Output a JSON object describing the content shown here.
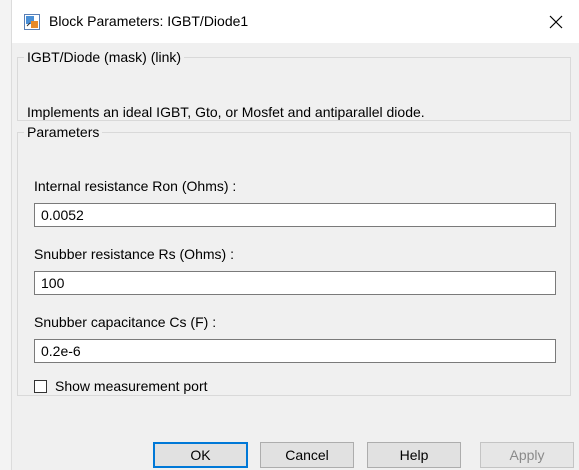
{
  "window": {
    "title": "Block Parameters: IGBT/Diode1",
    "icon": "simulink-block-icon",
    "close_icon": "close-icon"
  },
  "description_group": {
    "legend": "IGBT/Diode (mask) (link)",
    "text": "Implements an ideal  IGBT, Gto, or Mosfet and antiparallel diode."
  },
  "parameters_group": {
    "legend": "Parameters",
    "fields": [
      {
        "label": "Internal resistance Ron (Ohms) :",
        "value": "0.0052"
      },
      {
        "label": "Snubber resistance Rs (Ohms) :",
        "value": "100"
      },
      {
        "label": "Snubber capacitance Cs (F) :",
        "value": "0.2e-6"
      }
    ],
    "checkbox": {
      "label": "Show measurement port",
      "checked": false
    }
  },
  "buttons": {
    "ok": "OK",
    "cancel": "Cancel",
    "help": "Help",
    "apply": "Apply"
  },
  "colors": {
    "dialog_bg": "#f0f0f0",
    "focus_blue": "#0078d7",
    "disabled_text": "#8a8a8a"
  }
}
